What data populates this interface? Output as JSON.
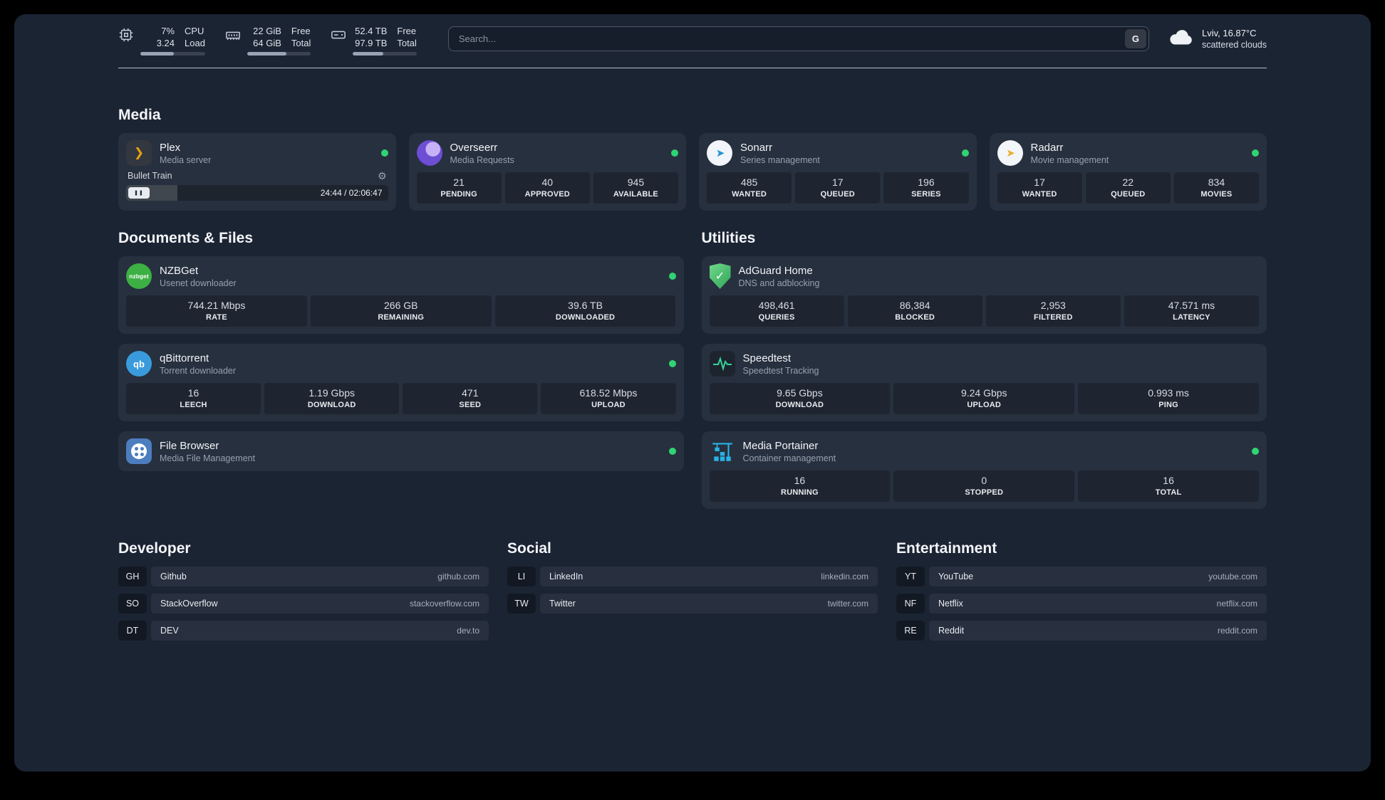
{
  "colors": {
    "status_green": "#2ed573",
    "accent_amber": "#e5a00d"
  },
  "topbar": {
    "cpu": {
      "value1": "7%",
      "value2": "3.24",
      "label1": "CPU",
      "label2": "Load",
      "bar_percent": 52
    },
    "memory": {
      "value1": "22 GiB",
      "value2": "64 GiB",
      "label1": "Free",
      "label2": "Total",
      "bar_percent": 62
    },
    "disk": {
      "value1": "52.4 TB",
      "value2": "97.9 TB",
      "label1": "Free",
      "label2": "Total",
      "bar_percent": 48
    },
    "search": {
      "placeholder": "Search...",
      "provider_label": "G"
    },
    "weather": {
      "location": "Lviv, 16.87°C",
      "condition": "scattered clouds"
    }
  },
  "sections": {
    "media": {
      "title": "Media",
      "cards": [
        {
          "name": "Plex",
          "desc": "Media server",
          "player": {
            "track": "Bullet Train",
            "time": "24:44 / 02:06:47",
            "progress_percent": 19.6
          }
        },
        {
          "name": "Overseerr",
          "desc": "Media Requests",
          "stats": [
            {
              "value": "21",
              "label": "PENDING"
            },
            {
              "value": "40",
              "label": "APPROVED"
            },
            {
              "value": "945",
              "label": "AVAILABLE"
            }
          ]
        },
        {
          "name": "Sonarr",
          "desc": "Series management",
          "stats": [
            {
              "value": "485",
              "label": "WANTED"
            },
            {
              "value": "17",
              "label": "QUEUED"
            },
            {
              "value": "196",
              "label": "SERIES"
            }
          ]
        },
        {
          "name": "Radarr",
          "desc": "Movie management",
          "stats": [
            {
              "value": "17",
              "label": "WANTED"
            },
            {
              "value": "22",
              "label": "QUEUED"
            },
            {
              "value": "834",
              "label": "MOVIES"
            }
          ]
        }
      ]
    },
    "documents": {
      "title": "Documents & Files",
      "cards": [
        {
          "name": "NZBGet",
          "desc": "Usenet downloader",
          "stats": [
            {
              "value": "744.21 Mbps",
              "label": "RATE"
            },
            {
              "value": "266 GB",
              "label": "REMAINING"
            },
            {
              "value": "39.6 TB",
              "label": "DOWNLOADED"
            }
          ]
        },
        {
          "name": "qBittorrent",
          "desc": "Torrent downloader",
          "stats": [
            {
              "value": "16",
              "label": "LEECH"
            },
            {
              "value": "1.19 Gbps",
              "label": "DOWNLOAD"
            },
            {
              "value": "471",
              "label": "SEED"
            },
            {
              "value": "618.52 Mbps",
              "label": "UPLOAD"
            }
          ]
        },
        {
          "name": "File Browser",
          "desc": "Media File Management"
        }
      ]
    },
    "utilities": {
      "title": "Utilities",
      "cards": [
        {
          "name": "AdGuard Home",
          "desc": "DNS and adblocking",
          "stats": [
            {
              "value": "498,461",
              "label": "QUERIES"
            },
            {
              "value": "86,384",
              "label": "BLOCKED"
            },
            {
              "value": "2,953",
              "label": "FILTERED"
            },
            {
              "value": "47.571 ms",
              "label": "LATENCY"
            }
          ]
        },
        {
          "name": "Speedtest",
          "desc": "Speedtest Tracking",
          "stats": [
            {
              "value": "9.65 Gbps",
              "label": "DOWNLOAD"
            },
            {
              "value": "9.24 Gbps",
              "label": "UPLOAD"
            },
            {
              "value": "0.993 ms",
              "label": "PING"
            }
          ]
        },
        {
          "name": "Media Portainer",
          "desc": "Container management",
          "stats": [
            {
              "value": "16",
              "label": "RUNNING"
            },
            {
              "value": "0",
              "label": "STOPPED"
            },
            {
              "value": "16",
              "label": "TOTAL"
            }
          ]
        }
      ]
    },
    "bookmarks": [
      {
        "title": "Developer",
        "items": [
          {
            "abbr": "GH",
            "name": "Github",
            "url": "github.com"
          },
          {
            "abbr": "SO",
            "name": "StackOverflow",
            "url": "stackoverflow.com"
          },
          {
            "abbr": "DT",
            "name": "DEV",
            "url": "dev.to"
          }
        ]
      },
      {
        "title": "Social",
        "items": [
          {
            "abbr": "LI",
            "name": "LinkedIn",
            "url": "linkedin.com"
          },
          {
            "abbr": "TW",
            "name": "Twitter",
            "url": "twitter.com"
          }
        ]
      },
      {
        "title": "Entertainment",
        "items": [
          {
            "abbr": "YT",
            "name": "YouTube",
            "url": "youtube.com"
          },
          {
            "abbr": "NF",
            "name": "Netflix",
            "url": "netflix.com"
          },
          {
            "abbr": "RE",
            "name": "Reddit",
            "url": "reddit.com"
          }
        ]
      }
    ]
  },
  "icons": {
    "nzbget_text": "nzbget",
    "qbittorrent_text": "qb"
  }
}
